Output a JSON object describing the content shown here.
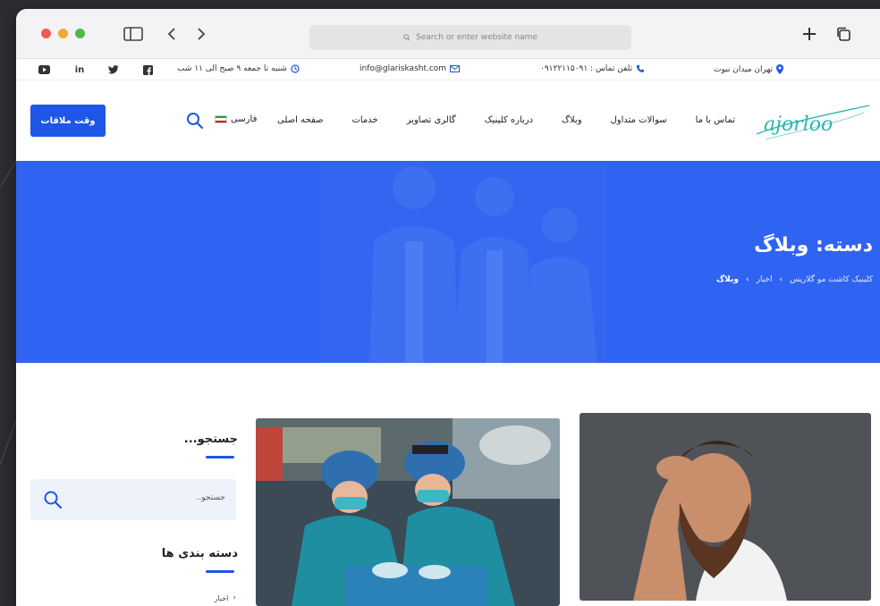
{
  "browser": {
    "url_placeholder": "Search or enter website name"
  },
  "topbar": {
    "location": "تهران میدان نبوت",
    "phone": "تلفن تماس : ۰۹۱۲۲۱۱۵۰۹۱",
    "email": "info@glariskasht.com",
    "hours": "شنبه تا جمعه ۹ صبح الی ۱۱ شب",
    "social": [
      "youtube-icon",
      "linkedin-icon",
      "twitter-icon",
      "facebook-icon"
    ]
  },
  "nav": {
    "appointment_button": "وقت ملاقات",
    "language": "فارسی",
    "menu": [
      "صفحه اصلی",
      "خدمات",
      "گالری تصاویر",
      "درباره کلینیک",
      "وبلاگ",
      "سوالات متداول",
      "تماس با ما"
    ],
    "logo_text": "ajorloo"
  },
  "hero": {
    "title": "دسته: وبلاگ",
    "breadcrumb": [
      "کلینیک کاشت مو گلاریس",
      "اخبار",
      "وبلاگ"
    ]
  },
  "sidebar": {
    "search_title": "جستجو...",
    "search_placeholder": "جستجو..",
    "categories_title": "دسته بندی ها",
    "categories": [
      "اخبار"
    ]
  },
  "colors": {
    "brand_blue": "#1e56e6",
    "hero_blue": "#2f63f1"
  }
}
